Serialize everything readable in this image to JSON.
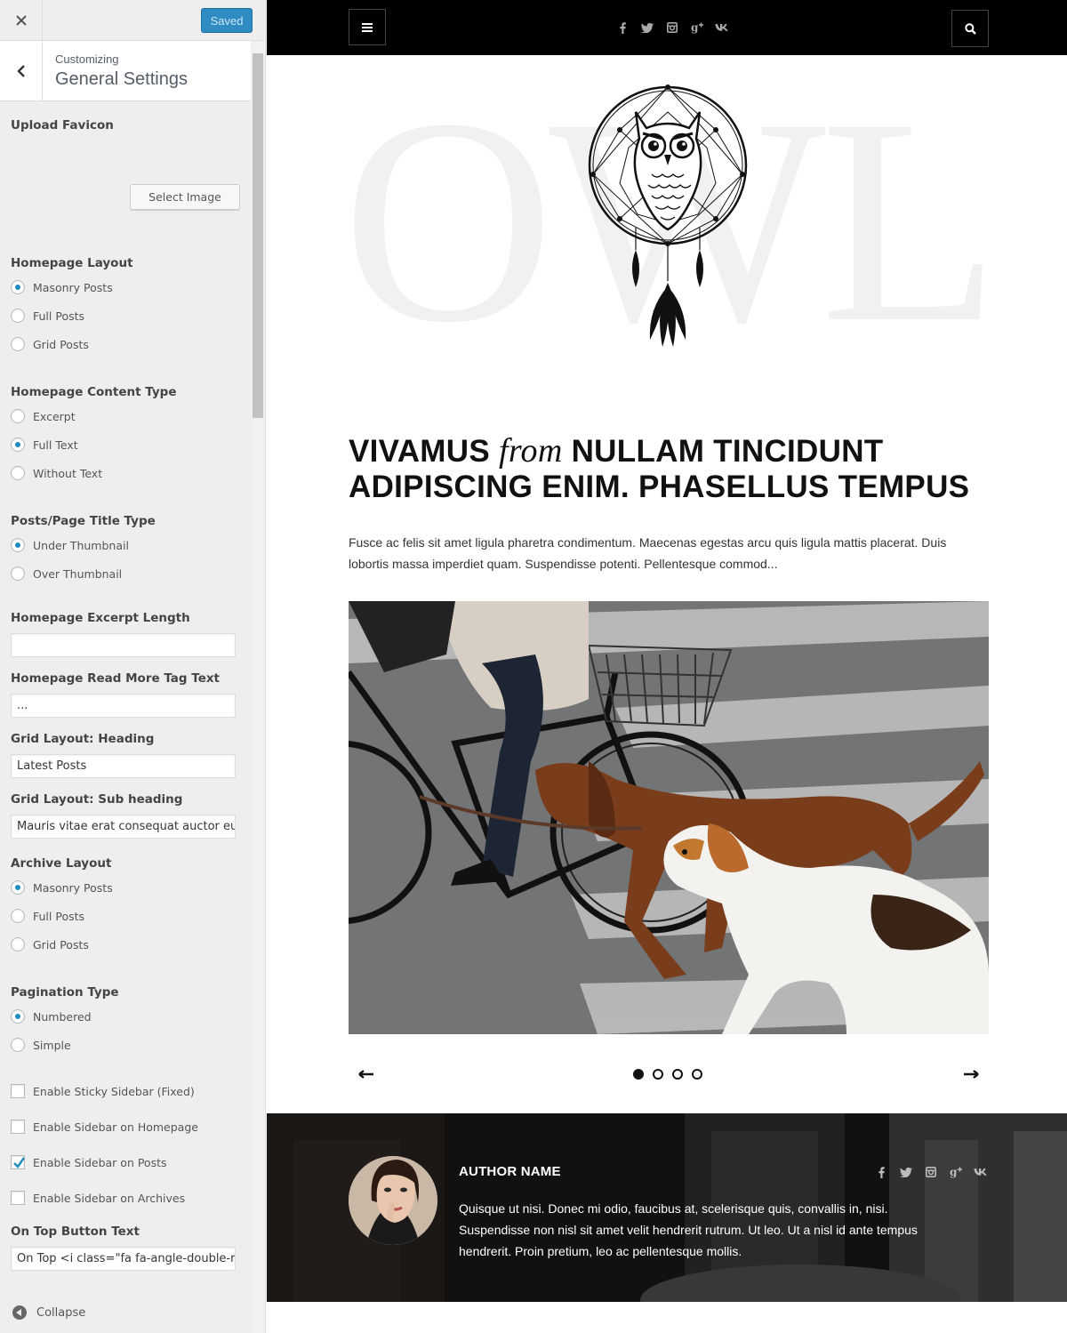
{
  "customizer": {
    "saved_label": "Saved",
    "customizing_label": "Customizing",
    "section_title": "General Settings",
    "favicon": {
      "label": "Upload Favicon",
      "button": "Select Image"
    },
    "homepage_layout": {
      "label": "Homepage Layout",
      "options": [
        "Masonry Posts",
        "Full Posts",
        "Grid Posts"
      ],
      "selected": "Masonry Posts"
    },
    "content_type": {
      "label": "Homepage Content Type",
      "options": [
        "Excerpt",
        "Full Text",
        "Without Text"
      ],
      "selected": "Full Text"
    },
    "title_type": {
      "label": "Posts/Page Title Type",
      "options": [
        "Under Thumbnail",
        "Over Thumbnail"
      ],
      "selected": "Under Thumbnail"
    },
    "excerpt_length": {
      "label": "Homepage Excerpt Length",
      "value": ""
    },
    "read_more": {
      "label": "Homepage Read More Tag Text",
      "value": "..."
    },
    "grid_heading": {
      "label": "Grid Layout: Heading",
      "value": "Latest Posts"
    },
    "grid_subheading": {
      "label": "Grid Layout: Sub heading",
      "value": "Mauris vitae erat consequat auctor eu"
    },
    "archive_layout": {
      "label": "Archive Layout",
      "options": [
        "Masonry Posts",
        "Full Posts",
        "Grid Posts"
      ],
      "selected": "Masonry Posts"
    },
    "pagination": {
      "label": "Pagination Type",
      "options": [
        "Numbered",
        "Simple"
      ],
      "selected": "Numbered"
    },
    "checkboxes": [
      {
        "label": "Enable Sticky Sidebar (Fixed)",
        "checked": false
      },
      {
        "label": "Enable Sidebar on Homepage",
        "checked": false
      },
      {
        "label": "Enable Sidebar on Posts",
        "checked": true
      },
      {
        "label": "Enable Sidebar on Archives",
        "checked": false
      }
    ],
    "on_top": {
      "label": "On Top Button Text",
      "value": "On Top <i class=\"fa fa-angle-double-r"
    },
    "collapse_label": "Collapse",
    "accent_color": "#1e8cbe"
  },
  "preview": {
    "top_social": [
      "facebook-icon",
      "twitter-icon",
      "instagram-icon",
      "google-plus-icon",
      "vk-icon"
    ],
    "watermark": "OWL",
    "post": {
      "title_part1": "VIVAMUS",
      "title_italic": "from",
      "title_part2": "NULLAM TINCIDUNT",
      "title_line2": "ADIPISCING ENIM. PHASELLUS TEMPUS",
      "excerpt": "Fusce ac felis sit amet ligula pharetra condimentum. Maecenas egestas arcu quis ligula mattis placerat. Duis lobortis massa imperdiet quam. Suspendisse potenti. Pellentesque commod..."
    },
    "slider": {
      "dots": 4,
      "active": 1
    },
    "author": {
      "name": "AUTHOR NAME",
      "bio": "Quisque ut nisi. Donec mi odio, faucibus at, scelerisque quis, convallis in, nisi. Suspendisse non nisl sit amet velit hendrerit rutrum. Ut leo. Ut a nisl id ante tempus hendrerit. Proin pretium, leo ac pellentesque mollis."
    }
  }
}
